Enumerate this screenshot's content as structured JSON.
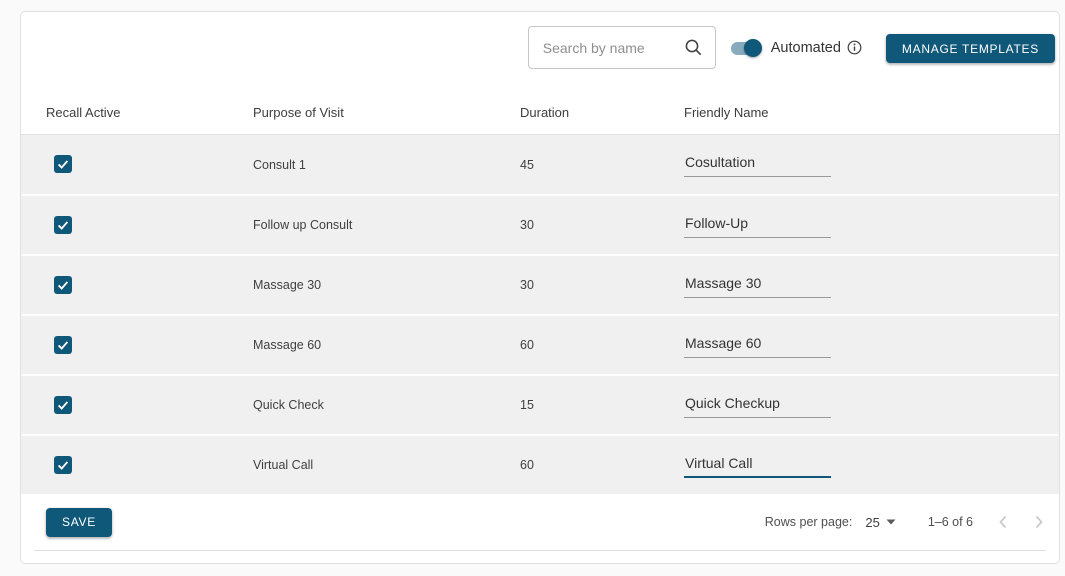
{
  "colors": {
    "accent": "#10587a",
    "toggle_track": "#87abbc",
    "row_background": "#f0f0f0",
    "page_background": "#fafafa"
  },
  "toolbar": {
    "search": {
      "placeholder": "Search by name",
      "value": ""
    },
    "toggle": {
      "label": "Automated",
      "state": "on"
    },
    "manage_templates_label": "MANAGE TEMPLATES"
  },
  "table": {
    "columns": [
      "Recall Active",
      "Purpose of Visit",
      "Duration",
      "Friendly Name"
    ],
    "rows": [
      {
        "recall_active": true,
        "purpose": "Consult 1",
        "duration": "45",
        "friendly_name": "Cosultation"
      },
      {
        "recall_active": true,
        "purpose": "Follow up Consult",
        "duration": "30",
        "friendly_name": "Follow-Up"
      },
      {
        "recall_active": true,
        "purpose": "Massage 30",
        "duration": "30",
        "friendly_name": "Massage 30"
      },
      {
        "recall_active": true,
        "purpose": "Massage 60",
        "duration": "60",
        "friendly_name": "Massage 60"
      },
      {
        "recall_active": true,
        "purpose": "Quick Check",
        "duration": "15",
        "friendly_name": "Quick Checkup"
      },
      {
        "recall_active": true,
        "purpose": "Virtual Call",
        "duration": "60",
        "friendly_name": "Virtual Call"
      }
    ]
  },
  "footer": {
    "save_label": "SAVE",
    "rows_per_page_label": "Rows per page:",
    "rows_per_page_value": "25",
    "range_label": "1–6 of 6"
  }
}
